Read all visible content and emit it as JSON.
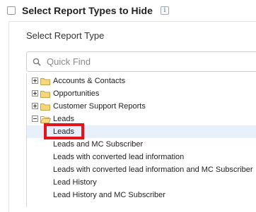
{
  "header": {
    "title": "Select Report Types to Hide",
    "info_glyph": "i",
    "checkbox_checked": false
  },
  "panel": {
    "label": "Select Report Type",
    "search": {
      "placeholder": "Quick Find",
      "value": ""
    }
  },
  "tree": {
    "items": [
      {
        "label": "Accounts & Contacts",
        "type": "folder",
        "expanded": false
      },
      {
        "label": "Opportunities",
        "type": "folder",
        "expanded": false
      },
      {
        "label": "Customer Support Reports",
        "type": "folder",
        "expanded": false
      },
      {
        "label": "Leads",
        "type": "folder",
        "expanded": true
      },
      {
        "label": "Leads",
        "type": "leaf",
        "selected": true
      },
      {
        "label": "Leads and MC Subscriber",
        "type": "leaf"
      },
      {
        "label": "Leads with converted lead information",
        "type": "leaf"
      },
      {
        "label": "Leads with converted lead information and MC Subscriber",
        "type": "leaf"
      },
      {
        "label": "Lead History",
        "type": "leaf"
      },
      {
        "label": "Lead History and MC Subscriber",
        "type": "leaf"
      }
    ]
  },
  "colors": {
    "highlight_box": "#e3141b",
    "folder": "#f5d77a",
    "selected_row": "#e8f1fb"
  },
  "icons": {
    "search": "search-icon",
    "folder": "folder-icon",
    "info": "info-icon"
  }
}
